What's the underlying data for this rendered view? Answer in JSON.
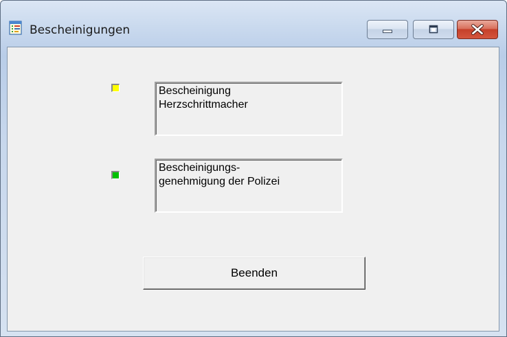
{
  "window": {
    "title": "Bescheinigungen",
    "app_icon": "document-list-icon",
    "controls": {
      "minimize_icon": "minimize-icon",
      "maximize_icon": "maximize-icon",
      "close_icon": "close-icon"
    }
  },
  "items": [
    {
      "status_color": "#ffff00",
      "label": "Bescheinigung\nHerzschrittmacher"
    },
    {
      "status_color": "#00c000",
      "label": "Bescheinigungs-\ngenehmigung der Polizei"
    }
  ],
  "buttons": {
    "quit_label": "Beenden"
  }
}
